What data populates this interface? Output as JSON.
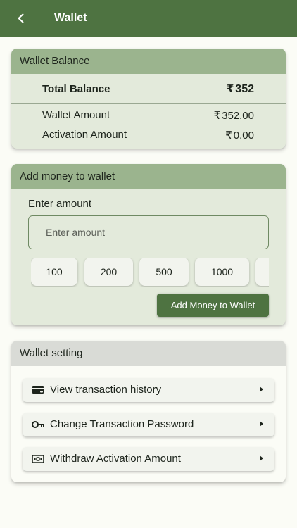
{
  "appbar": {
    "title": "Wallet"
  },
  "balance": {
    "header": "Wallet Balance",
    "currency_symbol": "₹",
    "total_label": "Total Balance",
    "total_value": "352",
    "wallet_amount_label": "Wallet Amount",
    "wallet_amount_value": "352.00",
    "activation_amount_label": "Activation Amount",
    "activation_amount_value": "0.00"
  },
  "add_money": {
    "header": "Add money to wallet",
    "enter_label": "Enter amount",
    "input_placeholder": "Enter amount",
    "input_value": "",
    "chips": [
      "100",
      "200",
      "500",
      "1000",
      ""
    ],
    "button_label": "Add Money to Wallet"
  },
  "settings": {
    "header": "Wallet setting",
    "items": [
      {
        "label": "View transaction history",
        "icon": "wallet-icon"
      },
      {
        "label": "Change Transaction Password",
        "icon": "key-icon"
      },
      {
        "label": "Withdraw Activation Amount",
        "icon": "cash-icon"
      }
    ]
  },
  "colors": {
    "primary": "#4e7341",
    "card_header": "#9bb48e",
    "card_body": "#e3eadb",
    "background": "#fbfcf6"
  }
}
